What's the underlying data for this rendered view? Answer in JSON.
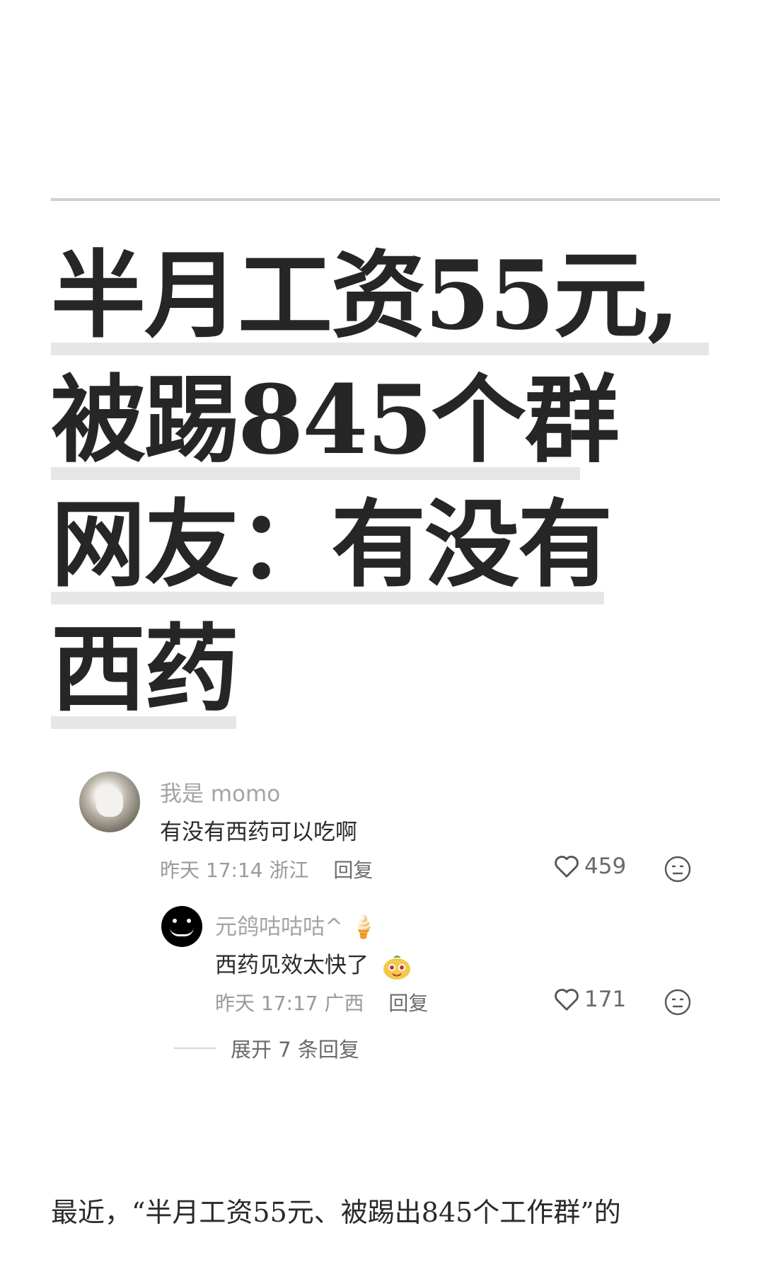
{
  "headline": {
    "lines": [
      "半月工资55元,",
      "被踢845个群",
      "网友：有没有",
      "西药"
    ]
  },
  "comments": [
    {
      "username": "我是 momo",
      "text": "有没有西药可以吃啊",
      "time": "昨天 17:14",
      "location": "浙江",
      "reply_label": "回复",
      "likes": "459"
    },
    {
      "username": "元鸽咕咕咕^",
      "username_emoji": "🍦",
      "text": "西药见效太快了",
      "time": "昨天 17:17",
      "location": "广西",
      "reply_label": "回复",
      "likes": "171"
    }
  ],
  "expand_replies": "展开 7 条回复",
  "body": {
    "paragraph_start": "最近，“半月工资55元、被踢出845个工作群”的"
  }
}
